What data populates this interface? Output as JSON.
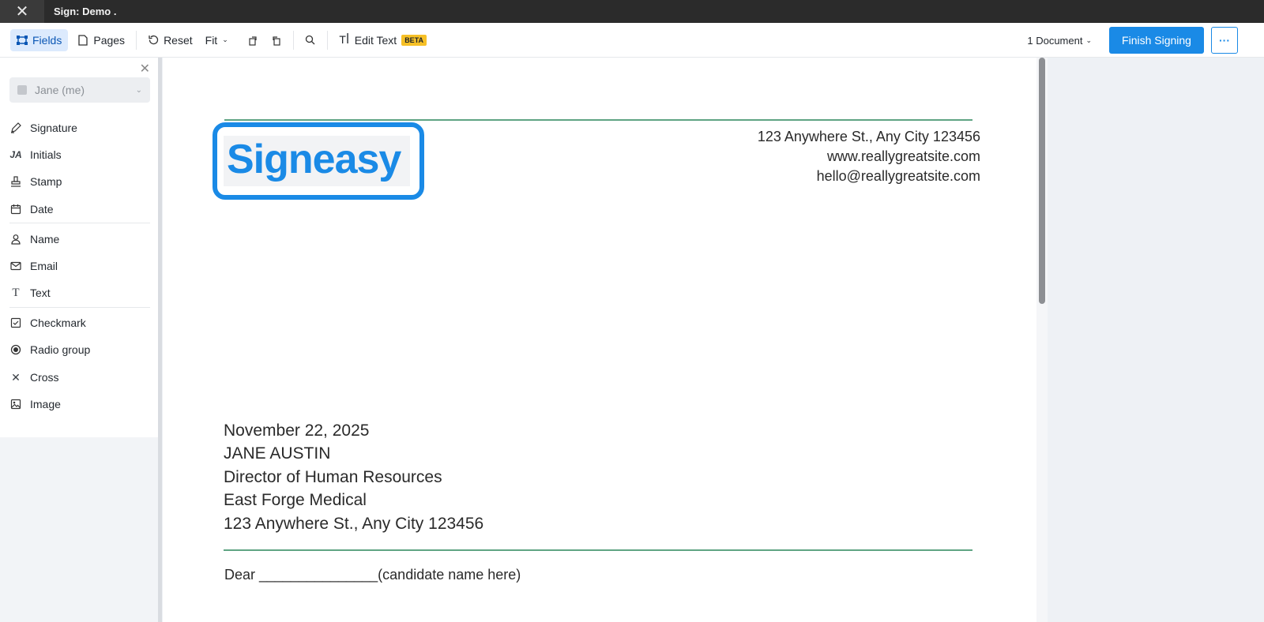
{
  "window": {
    "title": "Sign: Demo ."
  },
  "toolbar": {
    "fields_label": "Fields",
    "pages_label": "Pages",
    "reset_label": "Reset",
    "fit_label": "Fit",
    "edit_text_label": "Edit Text",
    "beta_badge": "BETA",
    "document_count": "1 Document",
    "finish_label": "Finish Signing",
    "more_label": "···"
  },
  "sidebar": {
    "signer": "Jane (me)",
    "items": [
      {
        "label": "Signature",
        "icon": "pen-icon"
      },
      {
        "label": "Initials",
        "icon": "initials-icon"
      },
      {
        "label": "Stamp",
        "icon": "stamp-icon"
      },
      {
        "label": "Date",
        "icon": "calendar-icon"
      },
      {
        "label": "Name",
        "icon": "person-icon"
      },
      {
        "label": "Email",
        "icon": "envelope-icon"
      },
      {
        "label": "Text",
        "icon": "text-icon"
      },
      {
        "label": "Checkmark",
        "icon": "checkbox-icon"
      },
      {
        "label": "Radio group",
        "icon": "radio-icon"
      },
      {
        "label": "Cross",
        "icon": "cross-icon"
      },
      {
        "label": "Image",
        "icon": "image-icon"
      }
    ]
  },
  "document": {
    "logo": "Signeasy",
    "address_lines": [
      "123 Anywhere St., Any City 123456",
      "www.reallygreatsite.com",
      "hello@reallygreatsite.com"
    ],
    "date": "November 22, 2025",
    "recipient_name": "JANE AUSTIN",
    "recipient_title": "Director of Human Resources",
    "recipient_company": "East Forge Medical",
    "recipient_address": "123 Anywhere St., Any City 123456",
    "salutation": "Dear _______________(candidate name here)"
  },
  "colors": {
    "accent": "#1a8ae6",
    "rule": "#5fa483",
    "titlebar": "#2b2b2b",
    "beta": "#f6c026"
  }
}
